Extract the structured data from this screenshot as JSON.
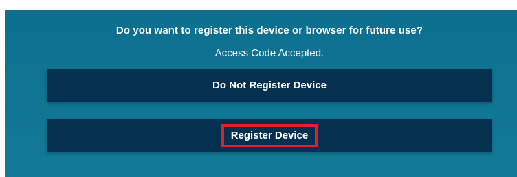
{
  "dialog": {
    "title": "Do you want to register this device or browser for future use?",
    "status": "Access Code Accepted.",
    "buttons": {
      "do_not_register": "Do Not Register Device",
      "register": "Register Device"
    }
  },
  "colors": {
    "panel_background": "#0e6f8f",
    "button_background": "#05304f",
    "highlight_border": "#e0202a",
    "text": "#ffffff"
  }
}
